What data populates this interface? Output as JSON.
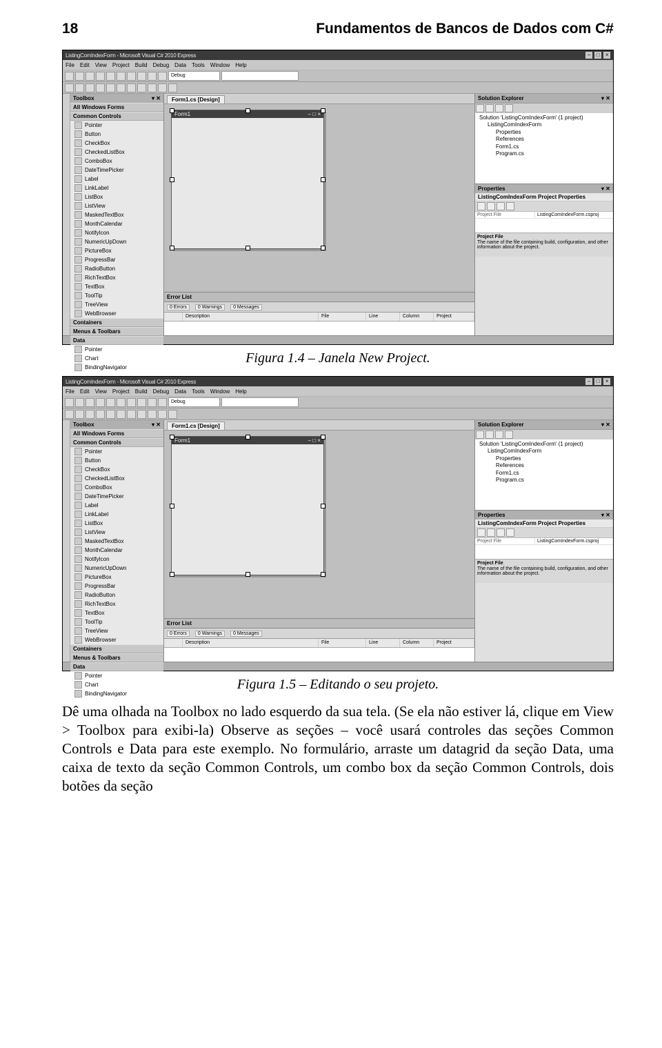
{
  "header": {
    "page_number": "18",
    "chapter_title": "Fundamentos de Bancos de Dados com C#"
  },
  "figure1": {
    "caption": "Figura 1.4 – Janela New Project."
  },
  "figure2": {
    "caption": "Figura 1.5 – Editando o seu projeto."
  },
  "ide": {
    "title": "ListingComIndexForm - Microsoft Visual C# 2010 Express",
    "menus": [
      "File",
      "Edit",
      "View",
      "Project",
      "Build",
      "Debug",
      "Data",
      "Tools",
      "Window",
      "Help"
    ],
    "toolbar_combo1": "Debug",
    "toolbox_title": "Toolbox",
    "toolbox_group1": "All Windows Forms",
    "toolbox_group2": "Common Controls",
    "toolbox_items": [
      "Pointer",
      "Button",
      "CheckBox",
      "CheckedListBox",
      "ComboBox",
      "DateTimePicker",
      "Label",
      "LinkLabel",
      "ListBox",
      "ListView",
      "MaskedTextBox",
      "MonthCalendar",
      "NotifyIcon",
      "NumericUpDown",
      "PictureBox",
      "ProgressBar",
      "RadioButton",
      "RichTextBox",
      "TextBox",
      "ToolTip",
      "TreeView",
      "WebBrowser"
    ],
    "toolbox_group3": "Containers",
    "toolbox_group4": "Menus & Toolbars",
    "toolbox_group5": "Data",
    "toolbox_data_items": [
      "Pointer",
      "Chart",
      "BindingNavigator"
    ],
    "doc_tab": "Form1.cs [Design]",
    "form_title": "Form1",
    "errorlist_title": "Error List",
    "error_tabs": [
      "0 Errors",
      "0 Warnings",
      "0 Messages"
    ],
    "error_cols": [
      "",
      "Description",
      "File",
      "Line",
      "Column",
      "Project"
    ],
    "solexp_title": "Solution Explorer",
    "tree": {
      "sol": "Solution 'ListingComIndexForm' (1 project)",
      "proj": "ListingComIndexForm",
      "n_prop": "Properties",
      "n_ref": "References",
      "n_form": "Form1.cs",
      "n_prog": "Program.cs"
    },
    "props_title": "Properties",
    "props_selected": "ListingComIndexForm Project Properties",
    "prop_row_label": "Project File",
    "prop_row_value": "ListingComIndexForm.csproj",
    "props_desc_title": "Project File",
    "props_desc_body": "The name of the file containing build, configuration, and other information about the project."
  },
  "body_text": "Dê uma olhada na Toolbox no lado esquerdo da sua tela. (Se ela não estiver lá, clique em View > Toolbox para exibi-la) Observe as seções – você usará controles das seções Common Controls e Data para este exemplo. No formulário, arraste um datagrid da seção Data, uma caixa de texto da seção Common Controls, um combo box da seção Common Controls, dois botões da seção"
}
